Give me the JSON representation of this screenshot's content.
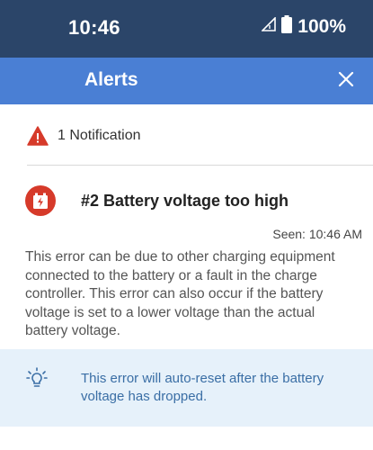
{
  "status_bar": {
    "time": "10:46",
    "battery_percent": "100%",
    "icons": [
      "signal-icon",
      "battery-icon"
    ]
  },
  "app_bar": {
    "title": "Alerts",
    "close_icon": "close-icon"
  },
  "notification_summary": {
    "count_text": "1 Notification",
    "icon": "warning-icon"
  },
  "alert": {
    "icon": "battery-charging-icon",
    "title": "#2 Battery voltage too high",
    "seen": "Seen: 10:46 AM",
    "description": "This error can be due to other charging equipment connected to the battery or a fault in the charge controller. This error can also occur if the battery voltage is set to a lower voltage than the actual battery voltage."
  },
  "hint": {
    "icon": "lightbulb-icon",
    "text": "This error will auto-reset after the battery voltage has dropped."
  },
  "colors": {
    "status_bar": "#2b4569",
    "app_bar": "#4a7fd4",
    "alert_red": "#d63a2a",
    "hint_background": "#e6f1fa",
    "hint_text": "#3a6ea5"
  }
}
